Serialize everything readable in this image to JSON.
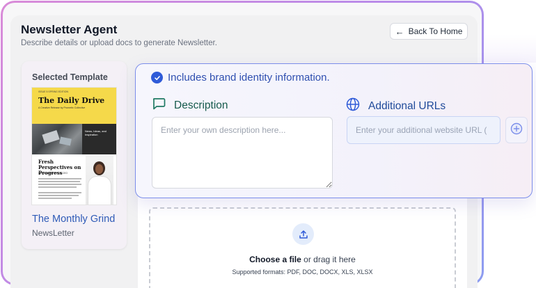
{
  "header": {
    "title": "Newsletter Agent",
    "subtitle": "Describe details or upload docs to generate Newsletter.",
    "back_label": "Back To Home"
  },
  "template_card": {
    "heading": "Selected Template",
    "name": "The Monthly Grind",
    "type": "NewsLetter",
    "thumbnail": {
      "masthead_small": "ISSUE 5 SPRING EDITION",
      "masthead": "The Daily Drive",
      "tagline": "A Creative Release by Prometix Collective",
      "side_text": "News, Ideas, and Inspiration",
      "feature_title": "Fresh Perspectives on Progress",
      "feature_sub": "Perspectives from Our CEO"
    }
  },
  "brand_info": {
    "label": "Includes brand identity information."
  },
  "description": {
    "label": "Description",
    "placeholder": "Enter your own description here..."
  },
  "urls": {
    "label": "Additional URLs",
    "placeholder": "Enter your additional website URL ("
  },
  "upload": {
    "choose": "Choose a file",
    "drag": " or drag it here",
    "formats": "Supported formats: PDF, DOC, DOCX, XLS, XLSX"
  },
  "colors": {
    "accent": "#2f5bd8",
    "frame_gradient_start": "#d98bd8",
    "frame_gradient_end": "#8c9cf0"
  }
}
